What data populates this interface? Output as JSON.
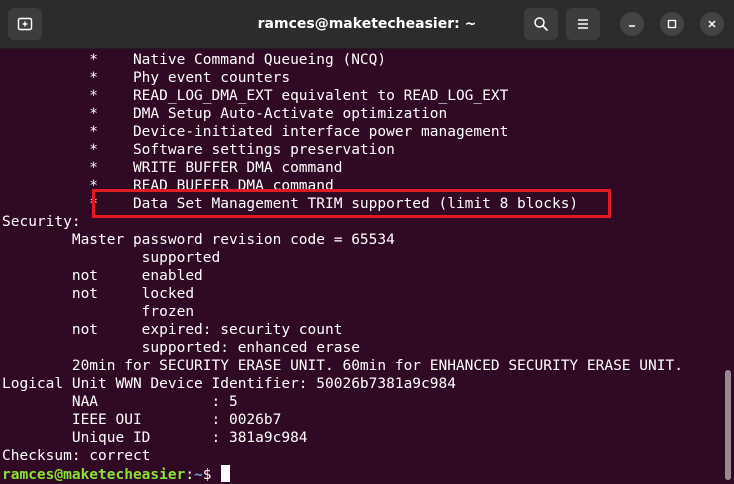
{
  "window": {
    "title": "ramces@maketecheasier: ~"
  },
  "icons": {
    "new_tab": "new-tab-icon",
    "search": "search-icon",
    "menu": "hamburger-menu-icon",
    "minimize": "minimize-icon",
    "maximize": "maximize-icon",
    "close": "close-icon"
  },
  "terminal": {
    "lines": [
      "          *    Native Command Queueing (NCQ)",
      "          *    Phy event counters",
      "          *    READ_LOG_DMA_EXT equivalent to READ_LOG_EXT",
      "          *    DMA Setup Auto-Activate optimization",
      "          *    Device-initiated interface power management",
      "          *    Software settings preservation",
      "          *    WRITE BUFFER DMA command",
      "          *    READ BUFFER DMA command",
      "          *    Data Set Management TRIM supported (limit 8 blocks)",
      "Security:",
      "        Master password revision code = 65534",
      "                supported",
      "        not     enabled",
      "        not     locked",
      "                frozen",
      "        not     expired: security count",
      "                supported: enhanced erase",
      "        20min for SECURITY ERASE UNIT. 60min for ENHANCED SECURITY ERASE UNIT.",
      "Logical Unit WWN Device Identifier: 50026b7381a9c984",
      "        NAA             : 5",
      "        IEEE OUI        : 0026b7",
      "        Unique ID       : 381a9c984",
      "Checksum: correct"
    ],
    "prompt": {
      "user_host": "ramces@maketecheasier",
      "separator": ":",
      "path": "~",
      "symbol": "$ "
    }
  },
  "colors": {
    "terminal_bg": "#300a24",
    "prompt_user": "#8ae234",
    "prompt_path": "#729fcf",
    "highlight": "#e01b24"
  }
}
